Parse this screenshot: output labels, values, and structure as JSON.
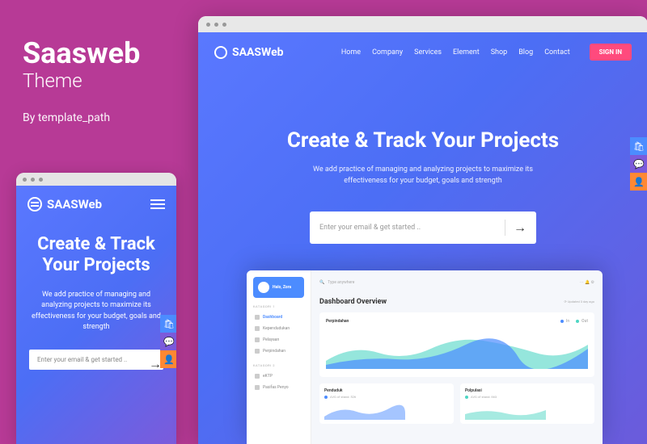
{
  "left": {
    "title": "Saasweb",
    "subtitle": "Theme",
    "byline": "By template_path"
  },
  "brand": {
    "name": "SAASWeb"
  },
  "nav": {
    "items": [
      "Home",
      "Company",
      "Services",
      "Element",
      "Shop",
      "Blog",
      "Contact"
    ],
    "signin": "SIGN IN"
  },
  "hero": {
    "title": "Create & Track Your Projects",
    "desc_desktop": "We add practice of managing and analyzing projects to maximize its effectiveness for your budget, goals and strength",
    "desc_mobile": "We add practice of managing and analyzing projects to maximize its effectiveness for your budget, goals and strength",
    "email_placeholder": "Enter your email & get started ..",
    "arrow": "→"
  },
  "dashboard": {
    "user": "Halo, Zora",
    "section1": "KATAGORI 1",
    "section2": "KATAGORI 2",
    "items1": [
      "Dashboard",
      "Kependudukan",
      "Pelayaan",
      "Perpindahan"
    ],
    "items2": [
      "eKTP",
      "Pasifas Penyo"
    ],
    "search": "Type anywhere",
    "title": "Dashboard Overview",
    "updated": "Updated 3 day ago",
    "main_chart": {
      "title": "Perpindahan",
      "legend": [
        {
          "label": "In",
          "color": "#4c8cff"
        },
        {
          "label": "Out",
          "color": "#4ed6c4"
        }
      ]
    },
    "small": [
      {
        "title": "Penduduk",
        "label": "AVG of stand: 526",
        "color": "#4c8cff"
      },
      {
        "title": "Polpulasi",
        "label": "AVG of stand: 663",
        "color": "#4ed6c4"
      }
    ]
  },
  "colors": {
    "accent": "#ff4a7d",
    "primary": "#4c8cff",
    "teal": "#4ed6c4",
    "purple": "#7b5bdb",
    "orange": "#ff8833"
  }
}
